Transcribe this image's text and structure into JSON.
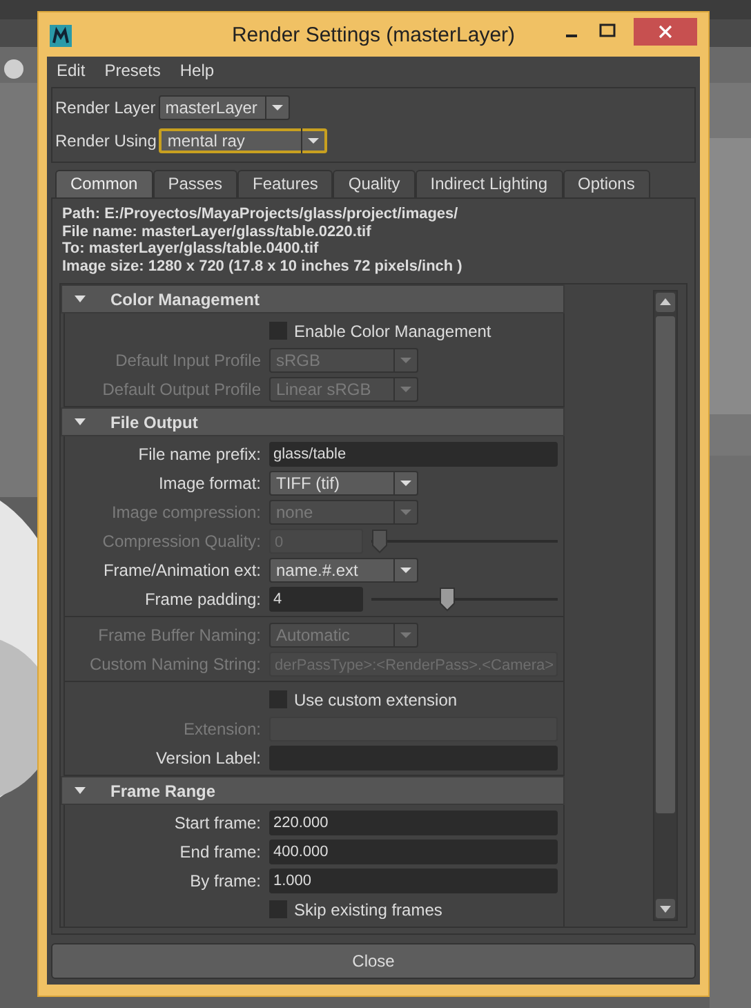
{
  "window": {
    "title": "Render Settings (masterLayer)"
  },
  "menu": [
    "Edit",
    "Presets",
    "Help"
  ],
  "header_rows": [
    {
      "label": "Render Layer",
      "value": "masterLayer",
      "highlighted": false
    },
    {
      "label": "Render Using",
      "value": "mental ray",
      "highlighted": true
    }
  ],
  "tabs": [
    {
      "label": "Common",
      "selected": true
    },
    {
      "label": "Passes",
      "selected": false
    },
    {
      "label": "Features",
      "selected": false
    },
    {
      "label": "Quality",
      "selected": false
    },
    {
      "label": "Indirect Lighting",
      "selected": false
    },
    {
      "label": "Options",
      "selected": false
    }
  ],
  "info": [
    {
      "label": "Path:",
      "value": "E:/Proyectos/MayaProjects/glass/project/images/"
    },
    {
      "label": "File name:",
      "value": "masterLayer/glass/table.0220.tif"
    },
    {
      "label": "To:",
      "value": "masterLayer/glass/table.0400.tif"
    },
    {
      "label": "Image size:",
      "value": "1280 x 720 (17.8 x 10 inches 72 pixels/inch )"
    }
  ],
  "sections": [
    {
      "title": "Color Management",
      "expanded": true,
      "groups": [
        [
          {
            "kind": "checkbox",
            "label": "Enable Color Management",
            "checked": false,
            "disabled": false
          },
          {
            "kind": "dropdown",
            "label": "Default Input Profile",
            "value": "sRGB",
            "disabled": true
          },
          {
            "kind": "dropdown",
            "label": "Default Output Profile",
            "value": "Linear sRGB",
            "disabled": true
          }
        ]
      ]
    },
    {
      "title": "File Output",
      "expanded": true,
      "groups": [
        [
          {
            "kind": "field",
            "label": "File name prefix:",
            "value": "glass/table",
            "disabled": false
          },
          {
            "kind": "dropdown",
            "label": "Image format:",
            "value": "TIFF (tif)",
            "disabled": false
          },
          {
            "kind": "dropdown",
            "label": "Image compression:",
            "value": "none",
            "disabled": true
          },
          {
            "kind": "slider",
            "label": "Compression Quality:",
            "value": "0",
            "level": 0,
            "disabled": true
          },
          {
            "kind": "dropdown",
            "label": "Frame/Animation ext:",
            "value": "name.#.ext",
            "disabled": false
          },
          {
            "kind": "slider",
            "label": "Frame padding:",
            "value": "4",
            "level": 0.4,
            "disabled": false
          }
        ],
        [
          {
            "kind": "dropdown",
            "label": "Frame Buffer Naming:",
            "value": "Automatic",
            "disabled": true
          },
          {
            "kind": "field",
            "label": "Custom Naming String:",
            "value": "derPassType>:<RenderPass>.<Camera>",
            "disabled": true
          }
        ],
        [
          {
            "kind": "checkbox",
            "label": "Use custom extension",
            "checked": false,
            "disabled": false
          },
          {
            "kind": "field",
            "label": "Extension:",
            "disabled": true
          },
          {
            "kind": "field",
            "label": "Version Label:",
            "disabled": false
          }
        ]
      ]
    },
    {
      "title": "Frame Range",
      "expanded": true,
      "groups": [
        [
          {
            "kind": "field",
            "label": "Start frame:",
            "value": "220.000",
            "disabled": false
          },
          {
            "kind": "field",
            "label": "End frame:",
            "value": "400.000",
            "disabled": false
          },
          {
            "kind": "field",
            "label": "By frame:",
            "value": "1.000",
            "disabled": false
          },
          {
            "kind": "checkbox",
            "label": "Skip existing frames",
            "checked": false,
            "disabled": false
          }
        ]
      ]
    }
  ],
  "close_button": "Close"
}
